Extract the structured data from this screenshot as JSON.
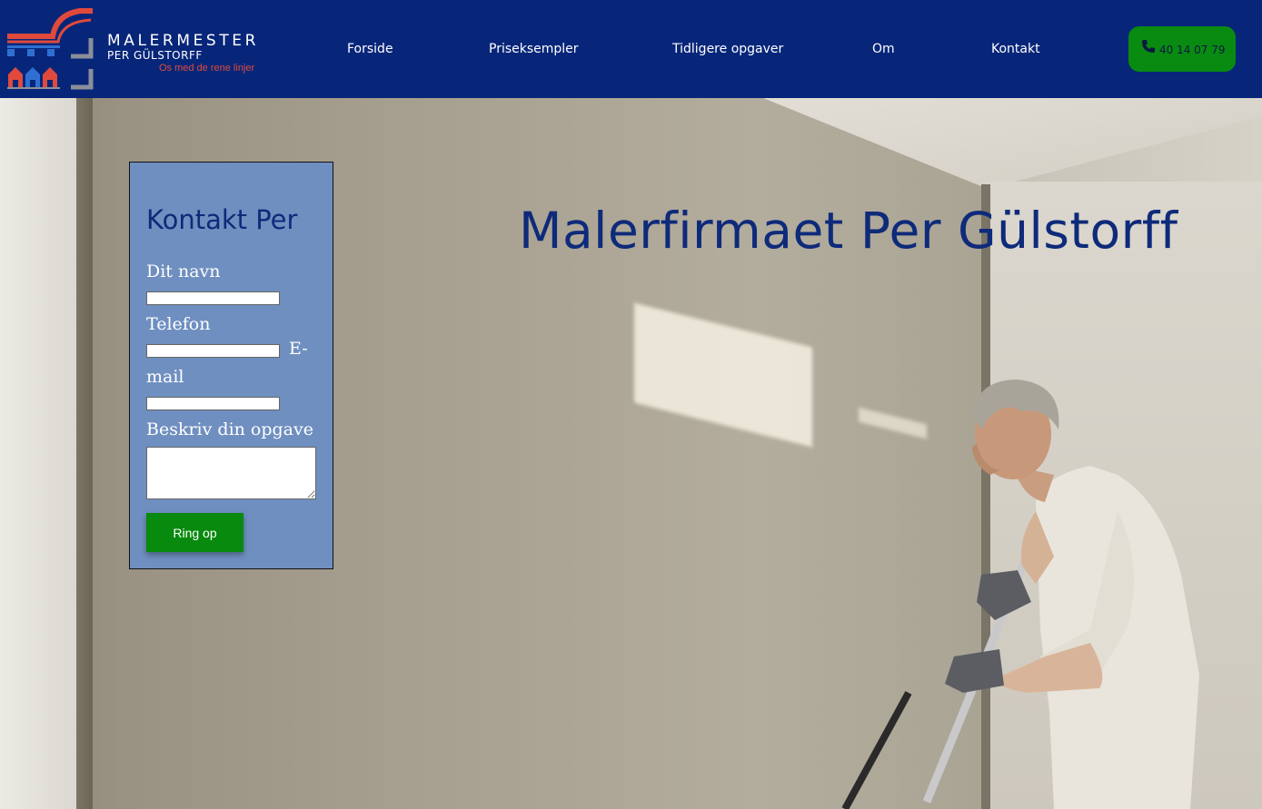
{
  "header": {
    "logo": {
      "title": "MALERMESTER",
      "subtitle": "PER GÜLSTORFF",
      "slogan": "Os med de rene linjer"
    },
    "nav": [
      {
        "label": "Forside"
      },
      {
        "label": "Priseksempler"
      },
      {
        "label": "Tidligere opgaver"
      },
      {
        "label": "Om"
      },
      {
        "label": "Kontakt"
      }
    ],
    "phone": {
      "icon": "phone-icon",
      "number": "40 14 07 79"
    }
  },
  "colors": {
    "header_bg": "#07267a",
    "accent_green": "#098a11",
    "form_bg": "#6f8fc0",
    "title_blue": "#0e2a7a",
    "slogan_red": "#e04a3c"
  },
  "contact_form": {
    "title": "Kontakt Per",
    "name_label": "Dit navn",
    "name_value": "",
    "phone_label": "Telefon",
    "phone_value": "",
    "email_label_1": "E-",
    "email_label_2": "mail",
    "email_value": "",
    "task_label": "Beskriv din opgave",
    "task_value": "",
    "submit_label": "Ring op"
  },
  "hero": {
    "title": "Malerfirmaet Per Gülstorff"
  }
}
